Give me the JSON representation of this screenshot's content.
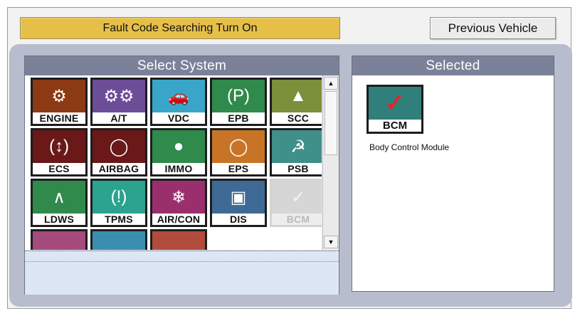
{
  "toolbar": {
    "fault_code_label": "Fault Code Searching Turn On",
    "previous_vehicle_label": "Previous Vehicle"
  },
  "select_system": {
    "title": "Select System",
    "tiles": [
      {
        "label": "ENGINE",
        "icon": "engine-icon",
        "color": "#8b3a14",
        "enabled": true
      },
      {
        "label": "A/T",
        "icon": "gears-icon",
        "color": "#6d4d98",
        "enabled": true
      },
      {
        "label": "VDC",
        "icon": "car-icon",
        "color": "#39a6c9",
        "enabled": true
      },
      {
        "label": "EPB",
        "icon": "parking-brake-icon",
        "color": "#2f8a4b",
        "enabled": true
      },
      {
        "label": "SCC",
        "icon": "cruise-control-icon",
        "color": "#7c8f3b",
        "enabled": true
      },
      {
        "label": "ECS",
        "icon": "suspension-icon",
        "color": "#6a1818",
        "enabled": true
      },
      {
        "label": "AIRBAG",
        "icon": "airbag-icon",
        "color": "#6a1818",
        "enabled": true
      },
      {
        "label": "IMMO",
        "icon": "immobilizer-icon",
        "color": "#2f8a4b",
        "enabled": true
      },
      {
        "label": "EPS",
        "icon": "steering-wheel-icon",
        "color": "#c87427",
        "enabled": true
      },
      {
        "label": "PSB",
        "icon": "seatbelt-icon",
        "color": "#3f8f8a",
        "enabled": true
      },
      {
        "label": "LDWS",
        "icon": "lane-departure-icon",
        "color": "#2f8a4b",
        "enabled": true
      },
      {
        "label": "TPMS",
        "icon": "tire-pressure-icon",
        "color": "#2aa38f",
        "enabled": true
      },
      {
        "label": "AIR/CON",
        "icon": "air-conditioner-icon",
        "color": "#9a2f6d",
        "enabled": true
      },
      {
        "label": "DIS",
        "icon": "display-icon",
        "color": "#3f6a95",
        "enabled": true
      },
      {
        "label": "BCM",
        "icon": "body-control-icon",
        "color": "#d6d6d6",
        "enabled": false
      }
    ],
    "partial_tiles": [
      {
        "icon": "partial-tile-icon",
        "color": "#a44a7c"
      },
      {
        "icon": "partial-tile-icon",
        "color": "#3a8fb0"
      },
      {
        "icon": "partial-tile-icon",
        "color": "#b14b3c"
      }
    ]
  },
  "selected": {
    "title": "Selected",
    "item": {
      "label": "BCM",
      "icon": "body-control-icon",
      "color": "#2f7f7a"
    },
    "description": "Body Control Module"
  }
}
